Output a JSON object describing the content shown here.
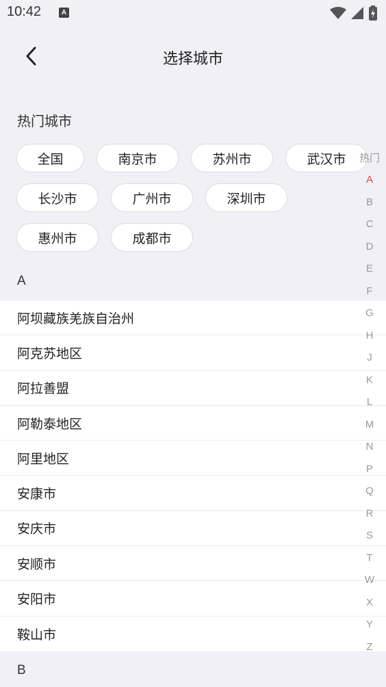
{
  "status": {
    "time": "10:42",
    "notification_badge": "A"
  },
  "nav": {
    "title": "选择城市",
    "back_icon": "chevron-left-icon"
  },
  "hot": {
    "title": "热门城市",
    "rows": [
      [
        "全国",
        "南京市",
        "苏州市",
        "武汉市"
      ],
      [
        "长沙市",
        "广州市",
        "深圳市"
      ],
      [
        "惠州市",
        "成都市"
      ]
    ]
  },
  "sections": [
    {
      "letter": "A",
      "cities": [
        "阿坝藏族羌族自治州",
        "阿克苏地区",
        "阿拉善盟",
        "阿勒泰地区",
        "阿里地区",
        "安康市",
        "安庆市",
        "安顺市",
        "安阳市",
        "鞍山市"
      ]
    },
    {
      "letter": "B",
      "cities": []
    }
  ],
  "index": {
    "items": [
      "热门",
      "A",
      "B",
      "C",
      "D",
      "E",
      "F",
      "G",
      "H",
      "J",
      "K",
      "L",
      "M",
      "N",
      "P",
      "Q",
      "R",
      "S",
      "T",
      "W",
      "X",
      "Y",
      "Z"
    ],
    "active": "A",
    "active_color": "#e0474c"
  }
}
